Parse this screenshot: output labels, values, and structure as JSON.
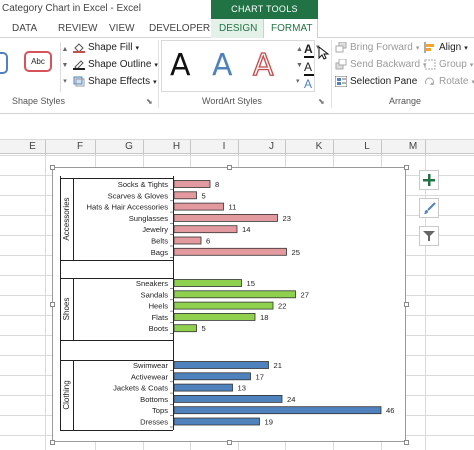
{
  "window": {
    "title": "Category Chart in Excel - Excel",
    "context_group": "CHART TOOLS"
  },
  "tabs": [
    "DATA",
    "REVIEW",
    "VIEW",
    "DEVELOPER",
    "DESIGN",
    "FORMAT"
  ],
  "ribbon": {
    "shape_styles": {
      "label": "Shape Styles",
      "thumb_text": "Abc",
      "fill": "Shape Fill",
      "outline": "Shape Outline",
      "effects": "Shape Effects"
    },
    "wordart_styles": {
      "label": "WordArt Styles",
      "letters": [
        "A",
        "A",
        "A"
      ]
    },
    "arrange": {
      "label": "Arrange",
      "bring_forward": "Bring Forward",
      "send_backward": "Send Backward",
      "selection_pane": "Selection Pane",
      "align": "Align",
      "group": "Group",
      "rotate": "Rotate"
    }
  },
  "columns": [
    "E",
    "F",
    "G",
    "H",
    "I",
    "J",
    "K",
    "L",
    "M"
  ],
  "colors": {
    "accessories": "#e29a9e",
    "shoes": "#8fd14f",
    "clothing": "#4f81bd",
    "excel_green": "#217346"
  },
  "chart_data": {
    "type": "bar",
    "orientation": "horizontal",
    "xlim": [
      0,
      50
    ],
    "groups": [
      {
        "name": "Accessories",
        "categories": [
          "Socks & Tights",
          "Scarves & Gloves",
          "Hats & Hair Accessories",
          "Sunglasses",
          "Jewelry",
          "Belts",
          "Bags"
        ],
        "values": [
          8,
          5,
          11,
          23,
          14,
          6,
          25
        ]
      },
      {
        "name": "Shoes",
        "categories": [
          "Sneakers",
          "Sandals",
          "Heels",
          "Flats",
          "Boots"
        ],
        "values": [
          15,
          27,
          22,
          18,
          5
        ]
      },
      {
        "name": "Clothing",
        "categories": [
          "Swimwear",
          "Activewear",
          "Jackets & Coats",
          "Bottoms",
          "Tops",
          "Dresses"
        ],
        "values": [
          21,
          17,
          13,
          24,
          46,
          19
        ]
      }
    ]
  }
}
